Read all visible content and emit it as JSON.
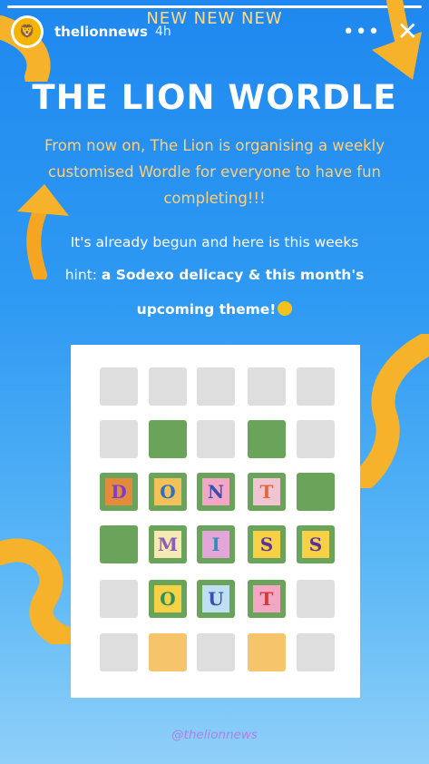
{
  "header": {
    "username": "thelionnews",
    "time": "4h",
    "more_icon": "more-horizontal-icon",
    "close_icon": "close-icon"
  },
  "banner": "NEW NEW NEW",
  "title": "THE LION WORDLE",
  "intro": "From now on, The Lion is organising a weekly customised Wordle for everyone to have fun completing!!!",
  "line1": "It's already begun and here is this weeks",
  "line2_prefix": "hint: ",
  "line2_bold": "a Sodexo delicacy & this month's",
  "line3": "upcoming theme!",
  "handle": "@thelionnews",
  "colors": {
    "green_tile": "#6aa35a",
    "yellow_tile": "#f6c46b",
    "gray_tile": "#dedede",
    "title": "#ffffff",
    "intro_text": "#ffcf7a",
    "background_top": "#1f88f0"
  },
  "board": {
    "rows": [
      [
        {
          "color": "gray",
          "letter": ""
        },
        {
          "color": "gray",
          "letter": ""
        },
        {
          "color": "gray",
          "letter": ""
        },
        {
          "color": "gray",
          "letter": ""
        },
        {
          "color": "gray",
          "letter": ""
        }
      ],
      [
        {
          "color": "gray",
          "letter": ""
        },
        {
          "color": "green",
          "letter": ""
        },
        {
          "color": "gray",
          "letter": ""
        },
        {
          "color": "green",
          "letter": ""
        },
        {
          "color": "gray",
          "letter": ""
        }
      ],
      [
        {
          "color": "green",
          "letter": "D",
          "bg": "#e58a3a",
          "fg": "#7b3fd0"
        },
        {
          "color": "green",
          "letter": "O",
          "bg": "#f2c15a",
          "fg": "#2f6fbd"
        },
        {
          "color": "green",
          "letter": "N",
          "bg": "#f3a7c5",
          "fg": "#3a4fb0"
        },
        {
          "color": "green",
          "letter": "T",
          "bg": "#f0c4d2",
          "fg": "#e0683a"
        },
        {
          "color": "green",
          "letter": ""
        }
      ],
      [
        {
          "color": "green",
          "letter": ""
        },
        {
          "color": "green",
          "letter": "M",
          "bg": "#f4e9b0",
          "fg": "#8f5ab8"
        },
        {
          "color": "green",
          "letter": "I",
          "bg": "#e4a6d8",
          "fg": "#2f8fb8"
        },
        {
          "color": "green",
          "letter": "S",
          "bg": "#f6d145",
          "fg": "#5a2f9e"
        },
        {
          "color": "green",
          "letter": "S",
          "bg": "#f6d145",
          "fg": "#5a2f9e"
        }
      ],
      [
        {
          "color": "gray",
          "letter": ""
        },
        {
          "color": "green",
          "letter": "O",
          "bg": "#f6d145",
          "fg": "#2f8f5a"
        },
        {
          "color": "green",
          "letter": "U",
          "bg": "#bfe0f2",
          "fg": "#3a4fb0"
        },
        {
          "color": "green",
          "letter": "T",
          "bg": "#f3a7c5",
          "fg": "#d03a3a"
        },
        {
          "color": "gray",
          "letter": ""
        }
      ],
      [
        {
          "color": "gray",
          "letter": ""
        },
        {
          "color": "yellow",
          "letter": ""
        },
        {
          "color": "gray",
          "letter": ""
        },
        {
          "color": "yellow",
          "letter": ""
        },
        {
          "color": "gray",
          "letter": ""
        }
      ]
    ]
  }
}
